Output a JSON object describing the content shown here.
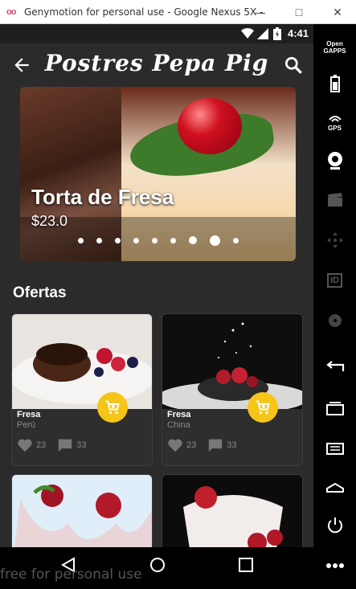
{
  "window": {
    "title": "Genymotion for personal use - Google Nexus 5X - ...",
    "logo": "oo",
    "controls": {
      "minimize": "—",
      "maximize": "□",
      "close": "✕"
    }
  },
  "statusbar": {
    "time": "4:41"
  },
  "appbar": {
    "title": "Postres Pepa Pig"
  },
  "hero": {
    "title": "Torta de Fresa",
    "price": "$23.0",
    "dots": 9,
    "active_dot_index": 7
  },
  "section": {
    "title": "Ofertas"
  },
  "products": [
    {
      "name": "Fresa",
      "origin": "Perú",
      "likes": "23",
      "comments": "33"
    },
    {
      "name": "Fresa",
      "origin": "China",
      "likes": "23",
      "comments": "33"
    }
  ],
  "sidebar": {
    "open_gapps": "Open\nGAPPS",
    "gps": "GPS",
    "id": "ID"
  },
  "watermark": "free for personal use",
  "colors": {
    "accent": "#f5c518",
    "background": "#2b2b2b",
    "card": "#2e2e2e"
  }
}
